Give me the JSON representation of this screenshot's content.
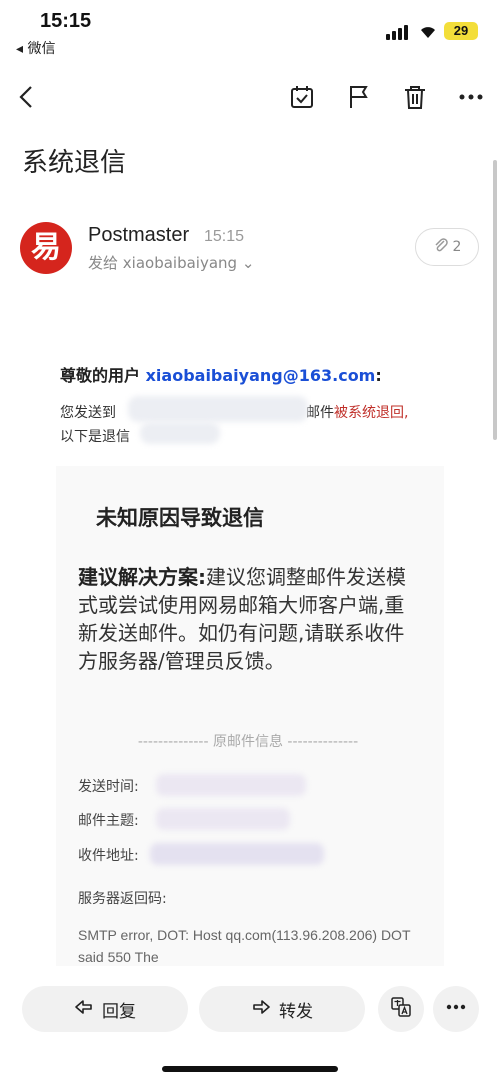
{
  "status_bar": {
    "time": "15:15",
    "back_app": "◂ 微信",
    "battery": "29"
  },
  "toolbar": {
    "icons": [
      "back-icon",
      "mark-done-icon",
      "flag-icon",
      "trash-icon",
      "more-icon"
    ]
  },
  "email": {
    "subject": "系统退信",
    "sender": {
      "name": "Postmaster",
      "time": "15:15",
      "avatar_char": "易",
      "to_prefix": "发给",
      "to": "xiaobaibaiyang",
      "avatar_color": "#d5251d"
    },
    "attachment_count": "2",
    "body": {
      "greeting_prefix": "尊敬的用户",
      "greeting_email": "xiaobaibaiyang@163.com",
      "greeting_suffix": ":",
      "line1_prefix": "您发送到",
      "line1_mid": "邮件",
      "line1_red": "被系统退回,",
      "line2": "以下是退信",
      "card_title": "未知原因导致退信",
      "advice_label": "建议解决方案:",
      "advice_text": "建议您调整邮件发送模式或尝试使用网易邮箱大师客户端,重新发送邮件。如仍有问题,请联系收件方服务器/管理员反馈。",
      "divider": "-------------- 原邮件信息 --------------",
      "meta": [
        {
          "label": "发送时间:"
        },
        {
          "label": "邮件主题:"
        },
        {
          "label": "收件地址:"
        }
      ],
      "server_label": "服务器返回码:",
      "smtp": "SMTP error, DOT: Host qq.com(113.96.208.206) DOT said 550 The"
    }
  },
  "actions": {
    "reply": "回复",
    "forward": "转发",
    "translate_icon": "translate-icon",
    "more_icon": "more-icon"
  }
}
